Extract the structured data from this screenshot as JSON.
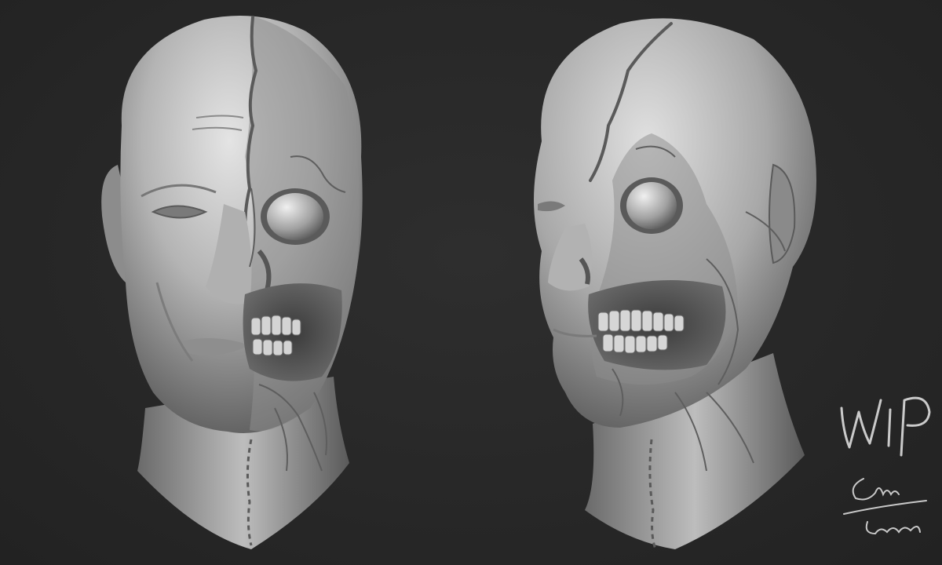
{
  "scene": {
    "background_color": "#282828",
    "clay_light": "#d8d8d8",
    "clay_mid": "#9a9a9a",
    "clay_dark": "#4a4a4a",
    "ink_color": "#c8c8c8"
  },
  "signature": {
    "wip_text": "WIP",
    "artist_name": "Chris Lowell"
  }
}
